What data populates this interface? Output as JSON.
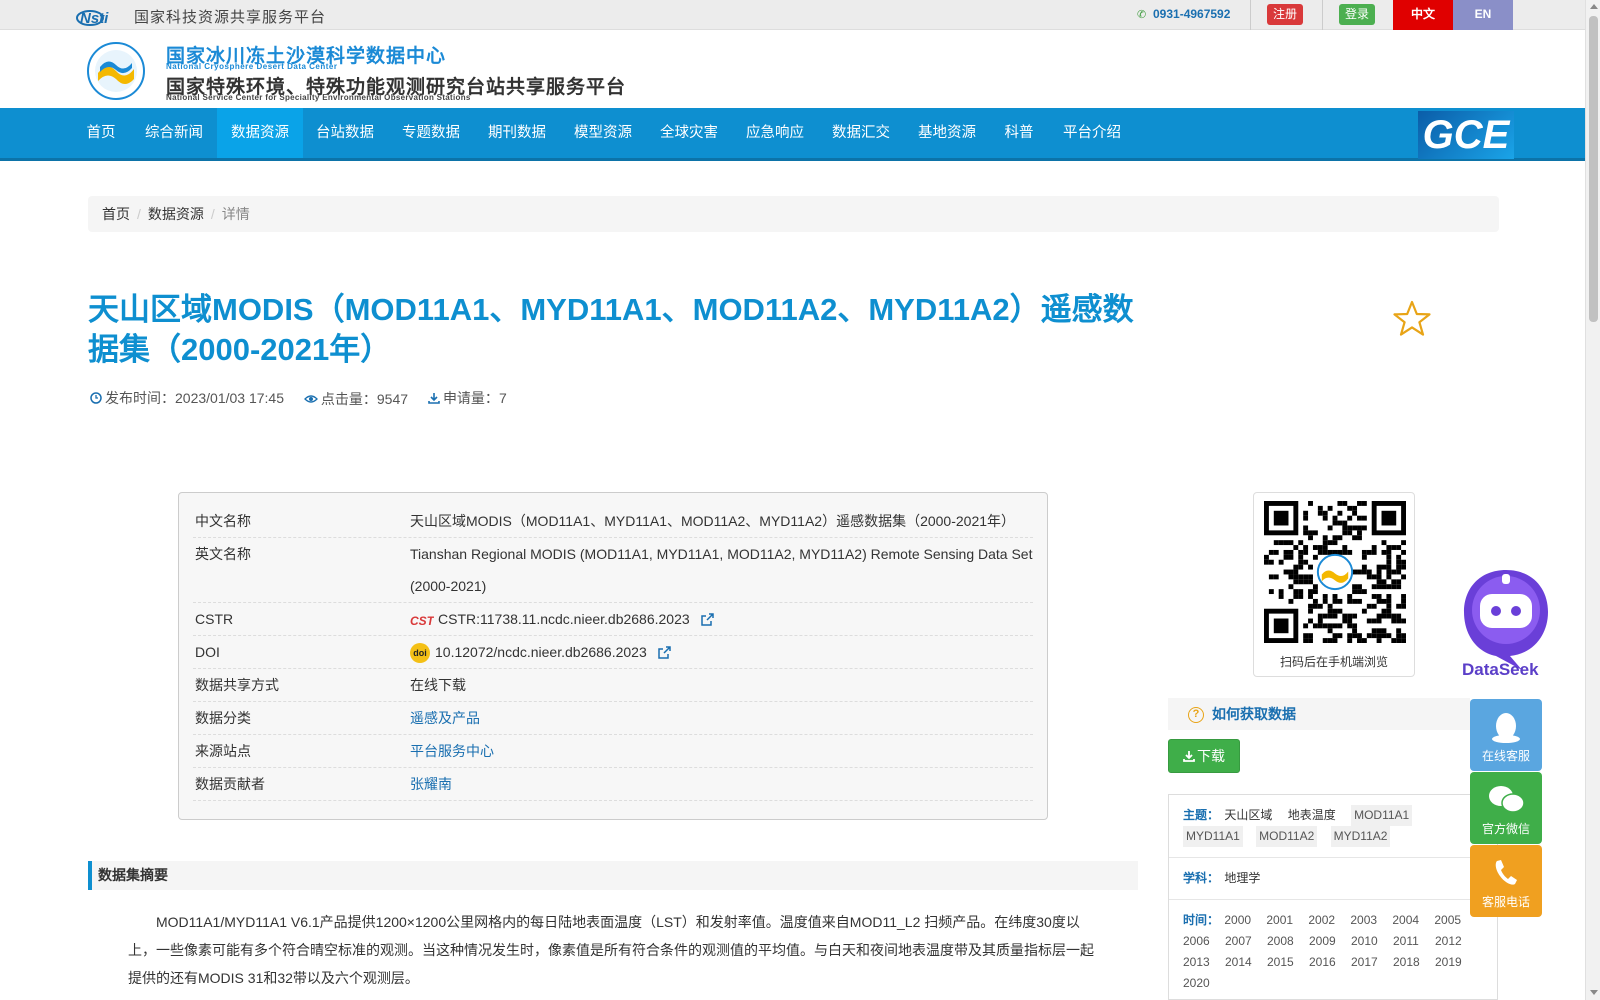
{
  "topbar": {
    "nsti_logo": "Nsti",
    "platform_name": "国家科技资源共享服务平台",
    "phone": "0931-4967592",
    "register_label": "注册",
    "login_label": "登录",
    "lang_zh": "中文",
    "lang_en": "EN"
  },
  "header": {
    "org_cn_1": "国家冰川冻土沙漠科学数据中心",
    "org_en_1": "National Cryosphere Desert Data Center",
    "org_cn_2": "国家特殊环境、特殊功能观测研究台站共享服务平台",
    "org_en_2": "National Service Center for Speciality Environmental Observation Stations"
  },
  "nav": {
    "items": [
      "首页",
      "综合新闻",
      "数据资源",
      "台站数据",
      "专题数据",
      "期刊数据",
      "模型资源",
      "全球灾害",
      "应急响应",
      "数据汇交",
      "基地资源",
      "科普",
      "平台介绍"
    ],
    "active_index": 2,
    "gce_label": "GCE"
  },
  "breadcrumb": [
    "首页",
    "数据资源",
    "详情"
  ],
  "dataset": {
    "title": "天山区域MODIS（MOD11A1、MYD11A1、MOD11A2、MYD11A2）遥感数据集（2000-2021年）",
    "publish_label": "发布时间：",
    "publish_time": "2023/01/03 17:45",
    "clicks_label": "点击量：",
    "clicks": "9547",
    "applies_label": "申请量：",
    "applies": "7"
  },
  "info": {
    "rows": [
      {
        "label": "中文名称",
        "value": "天山区域MODIS（MOD11A1、MYD11A1、MOD11A2、MYD11A2）遥感数据集（2000-2021年）"
      },
      {
        "label": "英文名称",
        "value": "Tianshan Regional MODIS (MOD11A1, MYD11A1, MOD11A2, MYD11A2) Remote Sensing Data Set (2000-2021)"
      },
      {
        "label": "CSTR",
        "value": "CSTR:11738.11.ncdc.nieer.db2686.2023"
      },
      {
        "label": "DOI",
        "value": "10.12072/ncdc.nieer.db2686.2023"
      },
      {
        "label": "数据共享方式",
        "value": "在线下载"
      },
      {
        "label": "数据分类",
        "value": "遥感及产品"
      },
      {
        "label": "来源站点",
        "value": "平台服务中心"
      },
      {
        "label": "数据贡献者",
        "value": "张耀南"
      }
    ],
    "cstr_badge": "CSTR",
    "doi_badge": "doi"
  },
  "abstract": {
    "heading": "数据集摘要",
    "text": "MOD11A1/MYD11A1 V6.1产品提供1200×1200公里网格内的每日陆地表面温度（LST）和发射率值。温度值来自MOD11_L2 扫频产品。在纬度30度以上，一些像素可能有多个符合晴空标准的观测。当这种情况发生时，像素值是所有符合条件的观测值的平均值。与白天和夜间地表温度带及其质量指标层一起提供的还有MODIS 31和32带以及六个观测层。"
  },
  "sidebar": {
    "qr_caption": "扫码后在手机端浏览",
    "howto_label": "如何获取数据",
    "download_label": "下载",
    "topic_label": "主题：",
    "topics": [
      "天山区域",
      "地表温度",
      "MOD11A1",
      "MYD11A1",
      "MOD11A2",
      "MYD11A2"
    ],
    "subject_label": "学科：",
    "subjects": [
      "地理学"
    ],
    "time_label": "时间：",
    "years": [
      "2000",
      "2001",
      "2002",
      "2003",
      "2004",
      "2005",
      "2006",
      "2007",
      "2008",
      "2009",
      "2010",
      "2011",
      "2012",
      "2013",
      "2014",
      "2015",
      "2016",
      "2017",
      "2018",
      "2019",
      "2020"
    ]
  },
  "floating": {
    "dataseek_label": "DataSeek",
    "online_service": "在线客服",
    "wechat": "官方微信",
    "phone_service": "客服电话",
    "colors": {
      "online": "#5aa6e0",
      "wechat": "#3fae49",
      "phone": "#f0a020"
    }
  },
  "colors": {
    "brand_blue": "#0e8fd0",
    "title_blue": "#0e8fd0",
    "register_red": "#d9393a",
    "login_green": "#4caf50",
    "lang_zh_bg": "#e00000",
    "lang_en_bg": "#8a8fc8"
  }
}
